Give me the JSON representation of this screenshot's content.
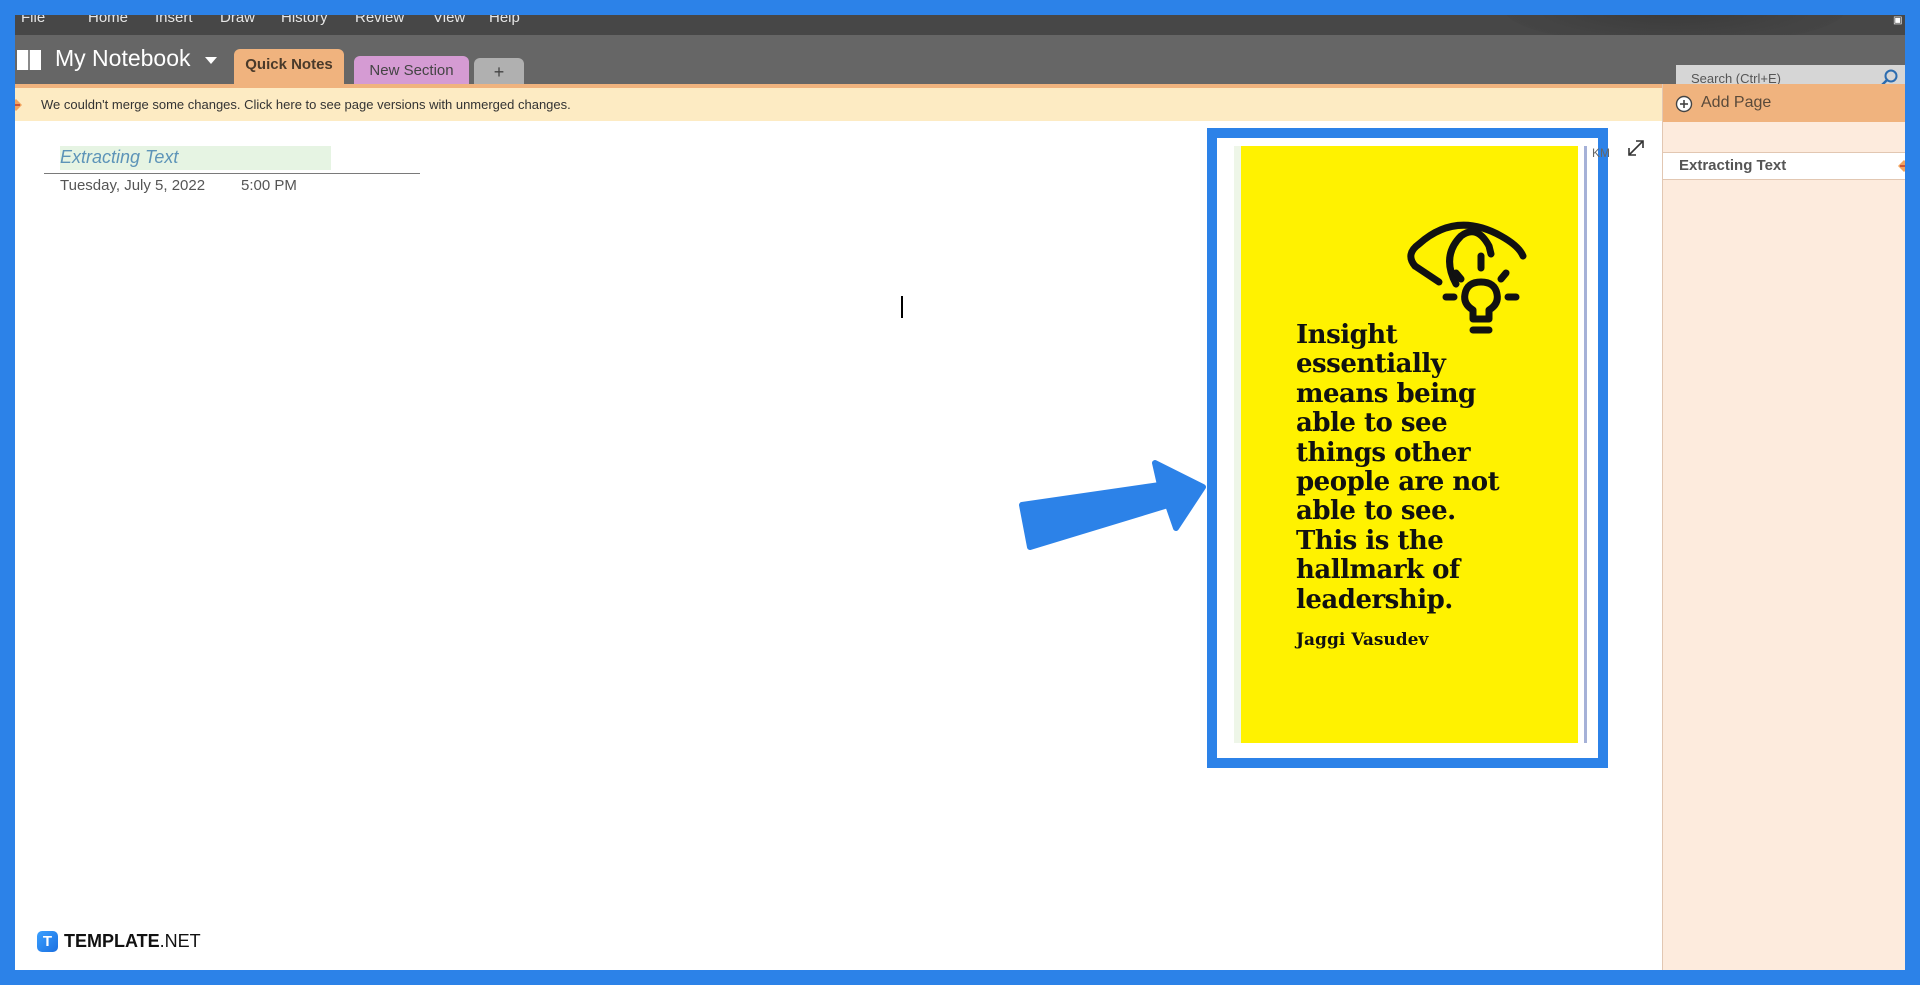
{
  "menu": {
    "items": [
      "File",
      "Home",
      "Insert",
      "Draw",
      "History",
      "Review",
      "View",
      "Help"
    ]
  },
  "notebook": {
    "title": "My Notebook",
    "icon": "notebook-icon",
    "dropdown_icon": "caret-down-icon"
  },
  "sections": {
    "tabs": [
      {
        "label": "Quick Notes",
        "active": true,
        "color": "#f0b37e"
      },
      {
        "label": "New Section",
        "active": false,
        "color": "#d59bd3"
      }
    ],
    "add_label": "+"
  },
  "search": {
    "placeholder": "Search (Ctrl+E)",
    "icon": "magnifier-icon"
  },
  "message_bar": {
    "text": "We couldn't merge some changes. Click here to see page versions with unmerged changes.",
    "icon": "merge-conflict-icon"
  },
  "page": {
    "title": "Extracting Text",
    "date": "Tuesday, July 5, 2022",
    "time": "5:00 PM"
  },
  "image": {
    "quote_lines": [
      "Insight",
      "essentially",
      "means being",
      "able to see",
      "things other",
      "people are not",
      "able to see.",
      "This is the",
      "hallmark of",
      "leadership."
    ],
    "author": "Jaggi Vasudev",
    "side_label": "KM",
    "background_color": "#fff200",
    "icon": "eye-lightbulb-icon"
  },
  "pages_panel": {
    "add_page_label": "Add Page",
    "pages": [
      {
        "label": "Extracting Text",
        "selected": true
      }
    ]
  },
  "annotation": {
    "frame_color": "#2c82e8",
    "arrow_color": "#2c82e8"
  },
  "watermark": {
    "logo_letter": "T",
    "brand_bold": "TEMPLATE",
    "brand_suffix": ".NET"
  }
}
